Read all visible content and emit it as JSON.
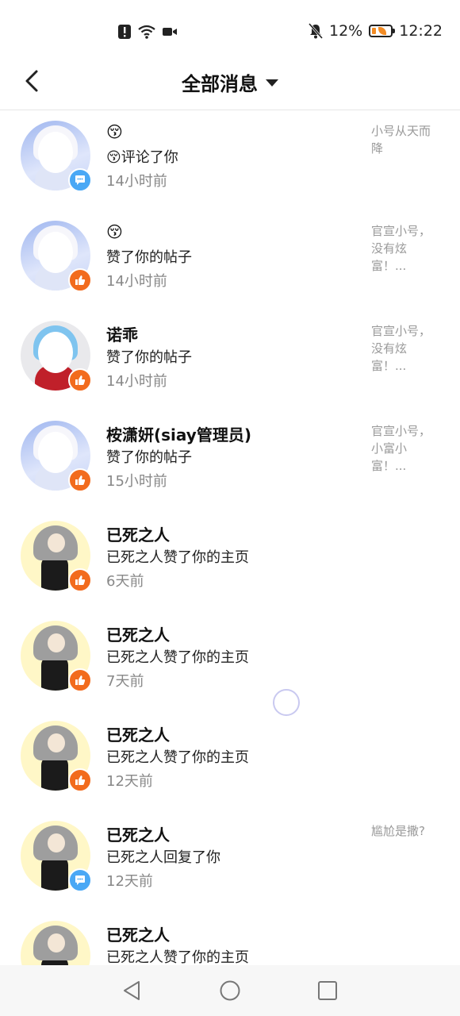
{
  "status_bar": {
    "battery_percent": "12%",
    "time": "12:22",
    "icons": [
      "alert-icon",
      "wifi-icon",
      "video-icon",
      "mute-bell-icon",
      "battery-icon"
    ]
  },
  "header": {
    "back_icon": "chevron-left-icon",
    "title": "全部消息",
    "dropdown_icon": "caret-down-icon"
  },
  "messages": [
    {
      "avatar": "blue",
      "name": "😚",
      "action": "😚评论了你",
      "time": "14小时前",
      "badge": "comment",
      "preview": "小号从天而降"
    },
    {
      "avatar": "blue",
      "name": "😚",
      "action": "赞了你的帖子",
      "time": "14小时前",
      "badge": "like",
      "preview": "官宣小号，没有炫富！..."
    },
    {
      "avatar": "gray",
      "name": "诺乖",
      "action": "赞了你的帖子",
      "time": "14小时前",
      "badge": "like",
      "preview": "官宣小号，没有炫富！..."
    },
    {
      "avatar": "blue",
      "name": "桉潇妍(siay管理员)",
      "action": "赞了你的帖子",
      "time": "15小时前",
      "badge": "like",
      "preview": "官宣小号，小富小富！..."
    },
    {
      "avatar": "yellow",
      "name": "已死之人",
      "action": "已死之人赞了你的主页",
      "time": "6天前",
      "badge": "like",
      "preview": ""
    },
    {
      "avatar": "yellow",
      "name": "已死之人",
      "action": "已死之人赞了你的主页",
      "time": "7天前",
      "badge": "like",
      "preview": ""
    },
    {
      "avatar": "yellow",
      "name": "已死之人",
      "action": "已死之人赞了你的主页",
      "time": "12天前",
      "badge": "like",
      "preview": ""
    },
    {
      "avatar": "yellow",
      "name": "已死之人",
      "action": "已死之人回复了你",
      "time": "12天前",
      "badge": "comment",
      "preview": "尴尬是撒?"
    },
    {
      "avatar": "yellow",
      "name": "已死之人",
      "action": "已死之人赞了你的主页",
      "time": "",
      "badge": "",
      "preview": ""
    }
  ],
  "nav_bar": {
    "buttons": [
      "back-triangle-icon",
      "home-circle-icon",
      "recents-square-icon"
    ]
  },
  "colors": {
    "like_badge": "#f26b1d",
    "comment_badge": "#4aa8f5",
    "time_text": "#888888",
    "preview_text": "#999999"
  }
}
